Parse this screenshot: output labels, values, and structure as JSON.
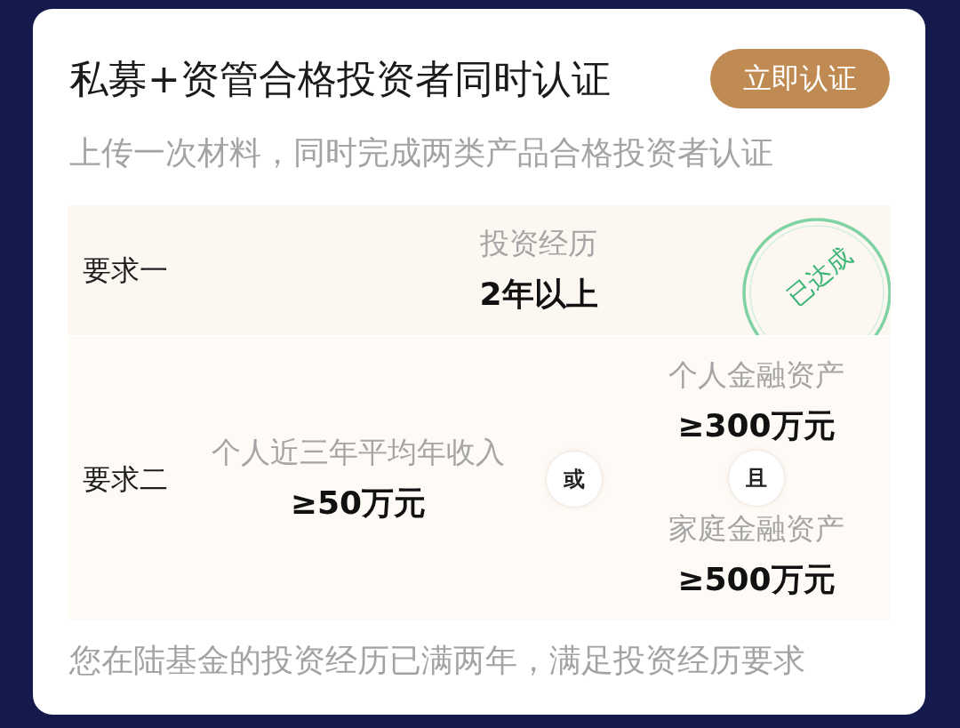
{
  "card": {
    "title": "私募+资管合格投资者同时认证",
    "action_button": "立即认证",
    "subtitle": "上传一次材料，同时完成两类产品合格投资者认证"
  },
  "requirements": [
    {
      "label": "要求一",
      "achieved": true,
      "stamp": "已达成",
      "options": [
        {
          "conditions": [
            {
              "name": "投资经历",
              "value": "2年以上"
            }
          ]
        }
      ]
    },
    {
      "label": "要求二",
      "achieved": false,
      "option_joiner": "或",
      "options": [
        {
          "conditions": [
            {
              "name": "个人近三年平均年收入",
              "value": "≥50万元"
            }
          ]
        },
        {
          "condition_joiner": "且",
          "conditions": [
            {
              "name": "个人金融资产",
              "value": "≥300万元"
            },
            {
              "name": "家庭金融资产",
              "value": "≥500万元"
            }
          ]
        }
      ]
    }
  ],
  "note": "您在陆基金的投资经历已满两年，满足投资经历要求"
}
